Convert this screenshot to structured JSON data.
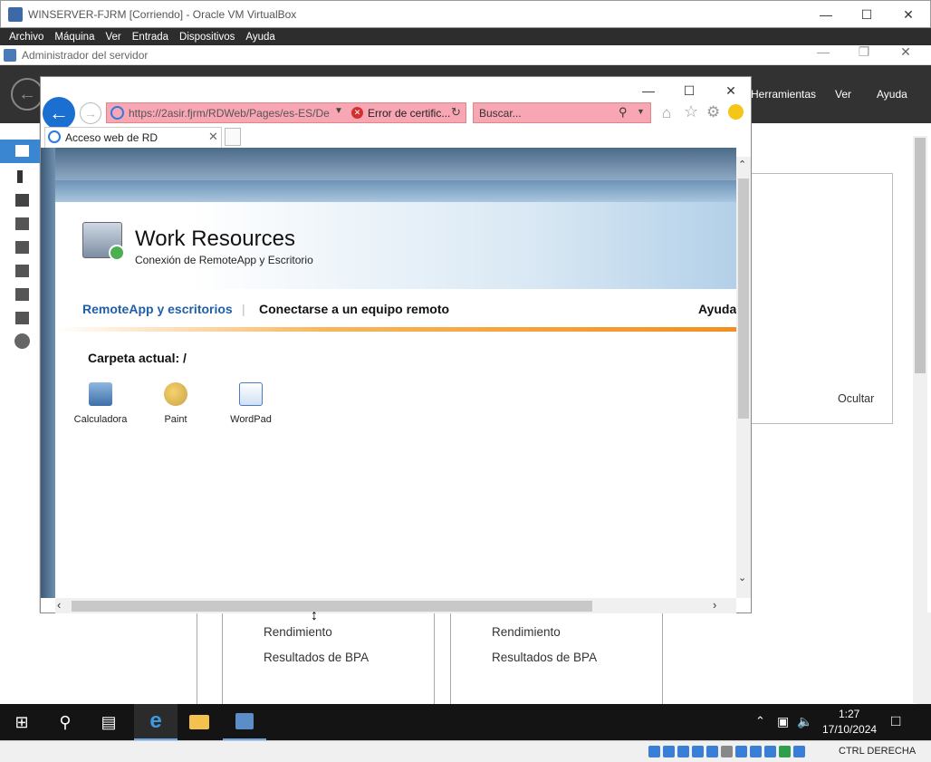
{
  "vbox": {
    "title": "WINSERVER-FJRM [Corriendo] - Oracle VM VirtualBox",
    "menu": [
      "Archivo",
      "Máquina",
      "Ver",
      "Entrada",
      "Dispositivos",
      "Ayuda"
    ]
  },
  "server_manager": {
    "title": "Administrador del servidor",
    "header_menu": [
      "Herramientas",
      "Ver",
      "Ayuda"
    ],
    "hide_label": "Ocultar",
    "bpa_rows": [
      "Rendimiento",
      "Resultados de BPA"
    ]
  },
  "ie": {
    "address": "https://2asir.fjrm/RDWeb/Pages/es-ES/De",
    "cert_error": "Error de certific...",
    "search_placeholder": "Buscar...",
    "tab_title": "Acceso web de RD"
  },
  "rdweb": {
    "title": "Work Resources",
    "subtitle": "Conexión de RemoteApp y Escritorio",
    "nav": {
      "remoteapp": "RemoteApp y escritorios",
      "connect": "Conectarse a un equipo remoto",
      "help": "Ayuda"
    },
    "current_folder": "Carpeta actual: /",
    "apps": [
      {
        "label": "Calculadora",
        "icon": "calculator-icon"
      },
      {
        "label": "Paint",
        "icon": "paint-palette-icon"
      },
      {
        "label": "WordPad",
        "icon": "wordpad-icon"
      }
    ]
  },
  "taskbar": {
    "time": "1:27",
    "date": "17/10/2024"
  },
  "vbox_status": {
    "host_key": "CTRL DERECHA"
  },
  "colors": {
    "ie_blue": "#1a6fd1",
    "address_error_bg": "#f8a6b4",
    "rd_link_blue": "#1f5fa8",
    "orange_accent": "#f19020"
  }
}
